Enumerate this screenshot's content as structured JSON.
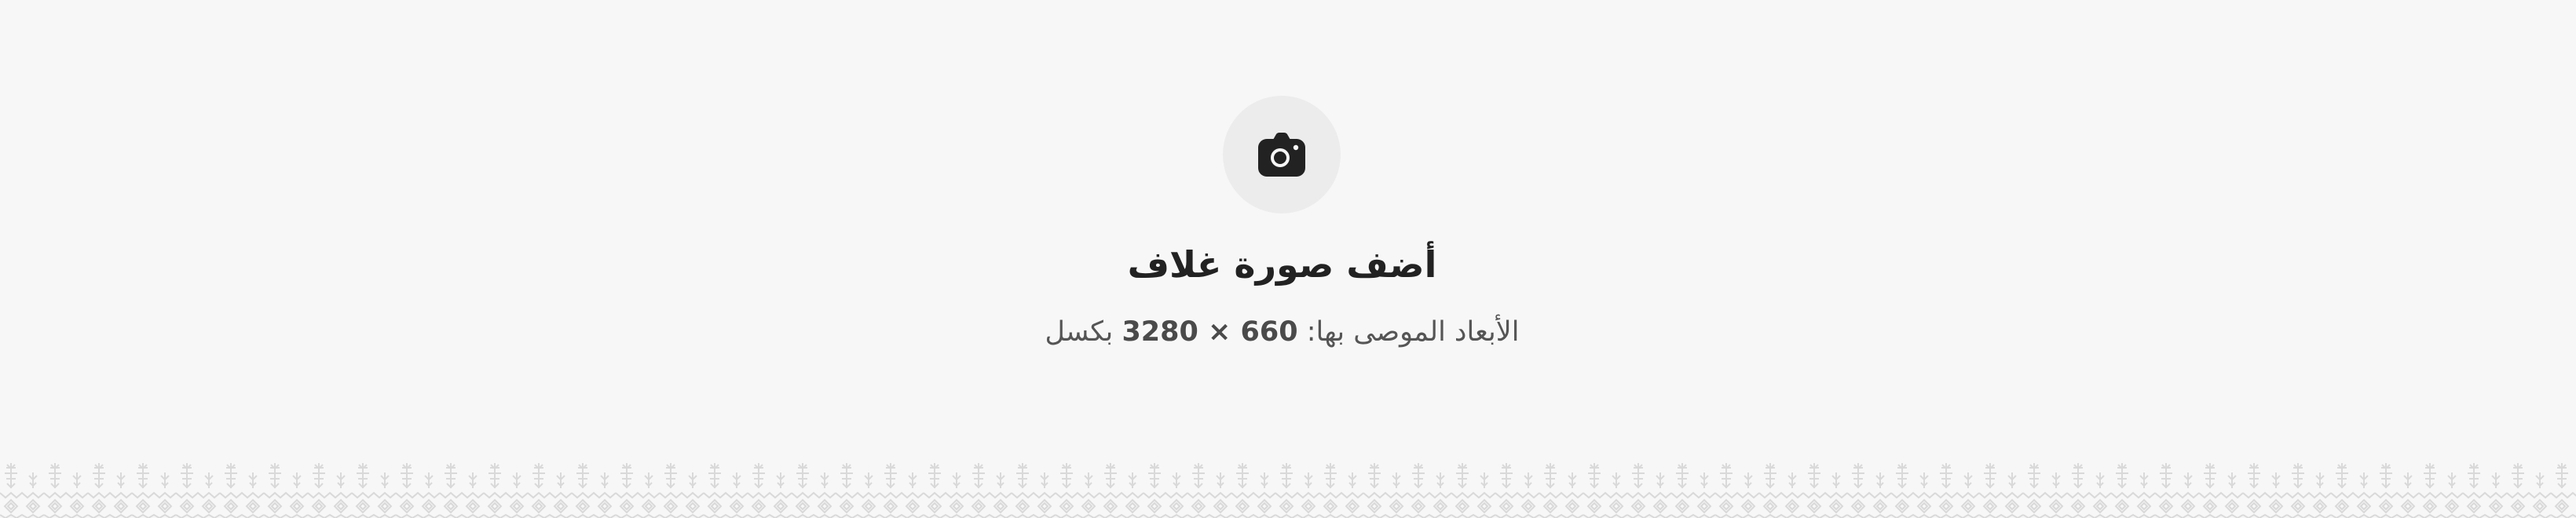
{
  "cover_upload": {
    "icon": "camera-icon",
    "title": "أضف صورة غلاف",
    "dimensions_prefix": "الأبعاد الموصى بها:",
    "dimensions_value": "3280 × 660",
    "dimensions_unit": "بكسل"
  },
  "colors": {
    "background": "#f7f7f7",
    "icon_circle": "#ececec",
    "icon": "#222222",
    "title": "#222222",
    "subtitle": "#555555",
    "pattern": "#d9d9d9"
  }
}
